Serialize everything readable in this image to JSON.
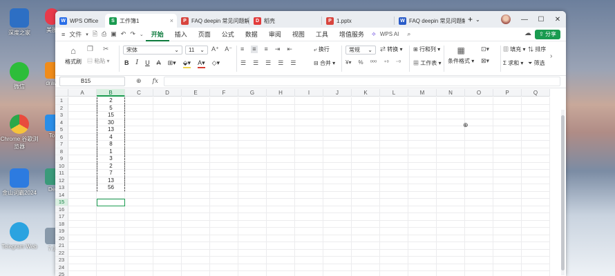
{
  "desktop": {
    "icons": [
      {
        "label": "深度之家",
        "color": "#2d6fc4"
      },
      {
        "label": "美图",
        "color": "#e83a4a"
      },
      {
        "label": "微信",
        "color": "#2dbd3a"
      },
      {
        "label": "draw",
        "color": "#f08c1a"
      },
      {
        "label": "Chrome 谷歌浏览器",
        "color": "#e84c3d"
      },
      {
        "label": "To",
        "color": "#2a8ee8"
      },
      {
        "label": "金山词霸2024",
        "color": "#2d7be0"
      },
      {
        "label": "De",
        "color": "#3a9a7a"
      },
      {
        "label": "Telegram Web",
        "color": "#2ba3e0"
      },
      {
        "label": "7.1",
        "color": "#8899aa"
      }
    ]
  },
  "tabs": [
    {
      "label": "WPS Office",
      "icon_color": "#2a6ee8",
      "icon_glyph": "W"
    },
    {
      "label": "工作簿1",
      "icon_color": "#1a9b50",
      "icon_glyph": "S",
      "active": true
    },
    {
      "label": "FAQ  deepin 常见问题解",
      "icon_color": "#d8453e",
      "icon_glyph": "P"
    },
    {
      "label": "稻壳",
      "icon_color": "#e23b3b",
      "icon_glyph": "D"
    },
    {
      "label": "1.pptx",
      "icon_color": "#d8453e",
      "icon_glyph": "P"
    },
    {
      "label": "FAQ  deepin 常见问题解",
      "icon_color": "#2a5cc8",
      "icon_glyph": "W"
    }
  ],
  "menubar": {
    "file": "文件",
    "items": [
      "开始",
      "插入",
      "页面",
      "公式",
      "数据",
      "审阅",
      "视图",
      "工具",
      "增值服务"
    ],
    "wps_ai": "WPS AI",
    "share": "分享"
  },
  "ribbon": {
    "format_painter": "格式刷",
    "paste": "粘贴",
    "font_name": "宋体",
    "font_size": "11",
    "wrap": "换行",
    "merge": "合并",
    "number_format": "常规",
    "convert": "转换",
    "row_col": "行和列",
    "worksheet": "工作表",
    "cond_format": "条件格式",
    "fill": "填充",
    "sort": "排序",
    "sum": "求和",
    "filter": "筛选"
  },
  "formula": {
    "name_box": "B15",
    "fx": "fx",
    "content": ""
  },
  "grid": {
    "columns": [
      "A",
      "B",
      "C",
      "D",
      "E",
      "F",
      "G",
      "H",
      "I",
      "J",
      "K",
      "L",
      "M",
      "N",
      "O",
      "P",
      "Q"
    ],
    "selected_column": "B",
    "selected_row": 15,
    "b_values": [
      "2",
      "5",
      "15",
      "30",
      "13",
      "4",
      "8",
      "1",
      "3",
      "2",
      "7",
      "13",
      "56"
    ],
    "row_count": 25
  },
  "colors": {
    "accent": "#1a9b50",
    "tab_bar": "#eaedf1"
  }
}
